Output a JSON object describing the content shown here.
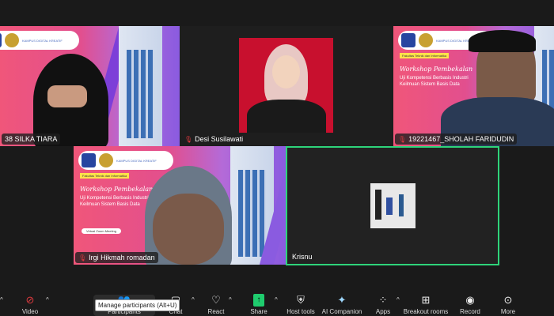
{
  "slide": {
    "faculty": "Fakultas Teknik dan Informatika",
    "campus": "KAMPUS DIGITAL KREATIF",
    "title": "Workshop Pembekalan",
    "subtitle1": "Uji Kompetensi Berbasis Industri",
    "subtitle2": "Keilmuan Sistem Basis Data",
    "meeting": "Virtual Zoom Meeting"
  },
  "participants": [
    {
      "name": "38 SILKA TIARA",
      "muted": true
    },
    {
      "name": "Desi Susilawati",
      "muted": true
    },
    {
      "name": "19221467_SHOLAH FARIDUDIN",
      "muted": true
    },
    {
      "name": "Irgi Hikmah romadan",
      "muted": true
    },
    {
      "name": "Krisnu",
      "muted": false,
      "active_speaker": true
    }
  ],
  "toolbar": {
    "video": "Video",
    "participants": "Participants",
    "chat": "Chat",
    "react": "React",
    "share": "Share",
    "host_tools": "Host tools",
    "ai": "AI Companion",
    "apps": "Apps",
    "breakout": "Breakout rooms",
    "record": "Record",
    "more": "More"
  },
  "tooltip": "Manage participants (Alt+U)",
  "colors": {
    "active": "#2ed47a",
    "share": "#1fcc6e",
    "muted": "#e0393e"
  }
}
